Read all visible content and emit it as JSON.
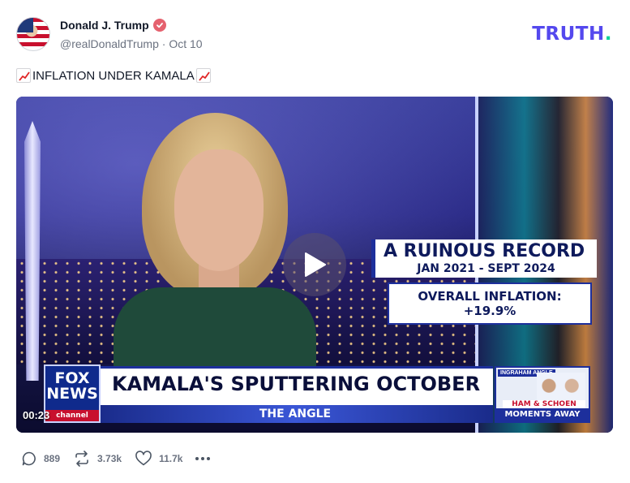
{
  "author": {
    "display_name": "Donald J. Trump",
    "handle": "@realDonaldTrump",
    "separator": "·",
    "date": "Oct 10",
    "verified": true
  },
  "brand": {
    "name": "TRUTH",
    "dot": "."
  },
  "post": {
    "text": "INFLATION UNDER KAMALA",
    "leading_icon": "chart-increasing-icon",
    "trailing_icon": "chart-increasing-icon"
  },
  "video": {
    "timestamp": "00:23",
    "graphic": {
      "line1": "A RUINOUS RECORD",
      "line2": "JAN 2021 - SEPT 2024",
      "stat": "OVERALL INFLATION: +19.9%"
    },
    "lower_third": {
      "headline": "KAMALA'S SPUTTERING OCTOBER",
      "show": "THE ANGLE"
    },
    "network": {
      "line1": "FOX",
      "line2": "NEWS",
      "channel": "channel"
    },
    "promo": {
      "top": "INGRAHAM ANGLE",
      "middle": "HAM & SCHOEN",
      "bottom": "MOMENTS AWAY"
    }
  },
  "actions": {
    "replies": "889",
    "reposts": "3.73k",
    "likes": "11.7k"
  },
  "colors": {
    "brand_purple": "#5448ee",
    "brand_green": "#0bd19a",
    "verified": "#e5616e",
    "muted": "#6b7280"
  }
}
